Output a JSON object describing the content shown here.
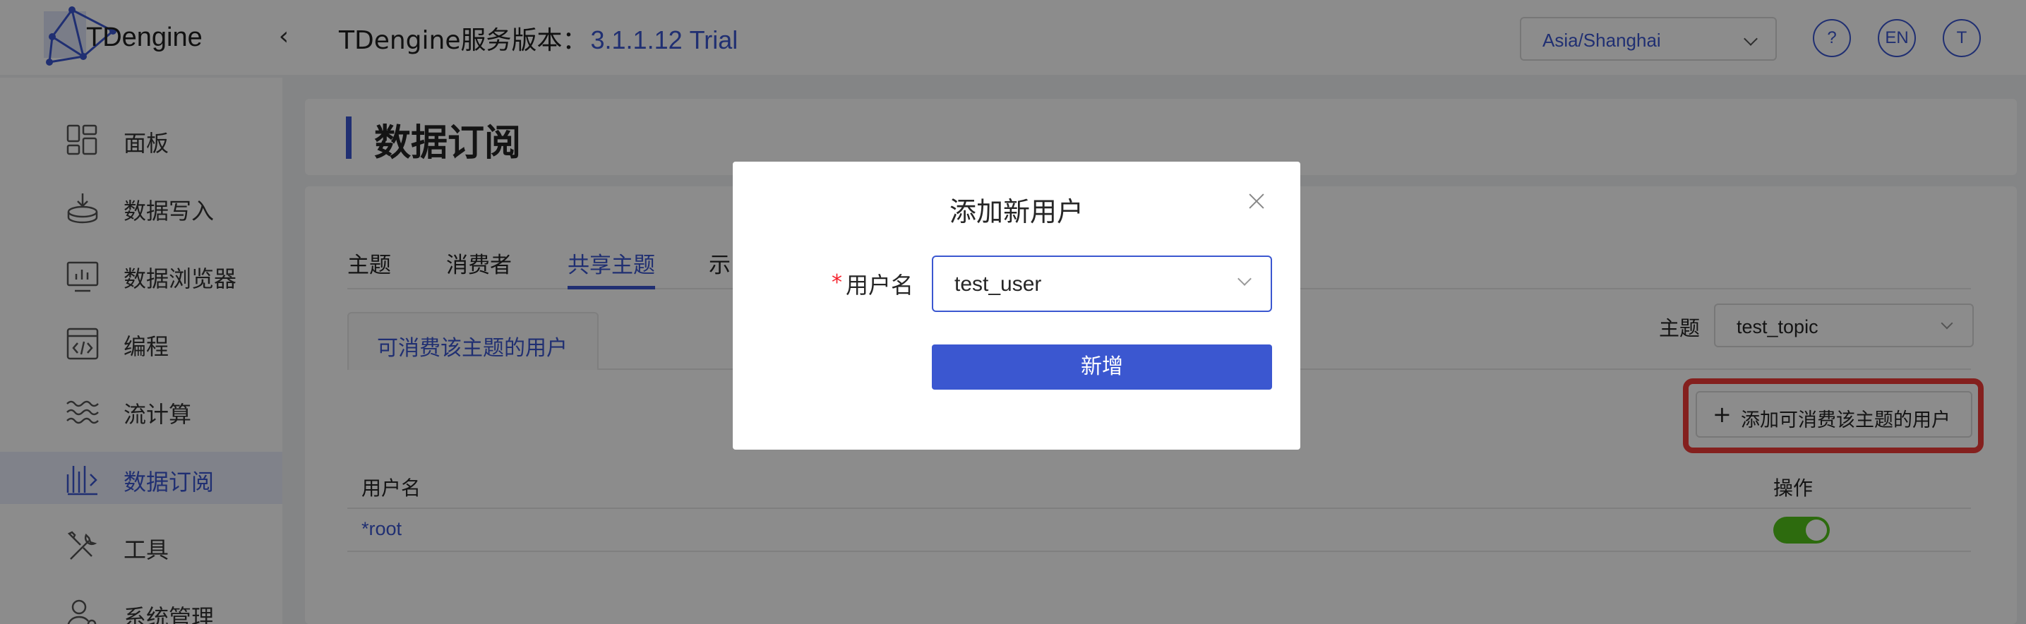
{
  "header": {
    "logo_text": "TDengine",
    "version_label": "TDengine服务版本：",
    "version_value": "3.1.1.12 Trial",
    "timezone": "Asia/Shanghai",
    "help_label": "?",
    "lang_label": "EN",
    "user_initial": "T"
  },
  "sidebar": {
    "items": [
      {
        "label": "面板",
        "icon": "dashboard-icon"
      },
      {
        "label": "数据写入",
        "icon": "data-ingest-icon"
      },
      {
        "label": "数据浏览器",
        "icon": "data-browser-icon"
      },
      {
        "label": "编程",
        "icon": "code-icon"
      },
      {
        "label": "流计算",
        "icon": "stream-icon"
      },
      {
        "label": "数据订阅",
        "icon": "subscription-icon",
        "active": true
      },
      {
        "label": "工具",
        "icon": "tools-icon"
      },
      {
        "label": "系统管理",
        "icon": "system-admin-icon"
      }
    ]
  },
  "page": {
    "title": "数据订阅",
    "tabs": [
      {
        "label": "主题"
      },
      {
        "label": "消费者"
      },
      {
        "label": "共享主题",
        "active": true
      },
      {
        "label": "示"
      }
    ],
    "subtab": "可消费该主题的用户",
    "topic_label": "主题",
    "topic_value": "test_topic",
    "add_button": "添加可消费该主题的用户",
    "table": {
      "headers": [
        "用户名",
        "操作"
      ],
      "rows": [
        {
          "user": "*root",
          "enabled": true
        }
      ]
    }
  },
  "modal": {
    "title": "添加新用户",
    "required_mark": "*",
    "field_label": "用户名",
    "field_value": "test_user",
    "submit": "新增"
  },
  "colors": {
    "accent": "#3b57d0",
    "highlight": "#f03b37",
    "toggle_on": "#52c41a"
  }
}
